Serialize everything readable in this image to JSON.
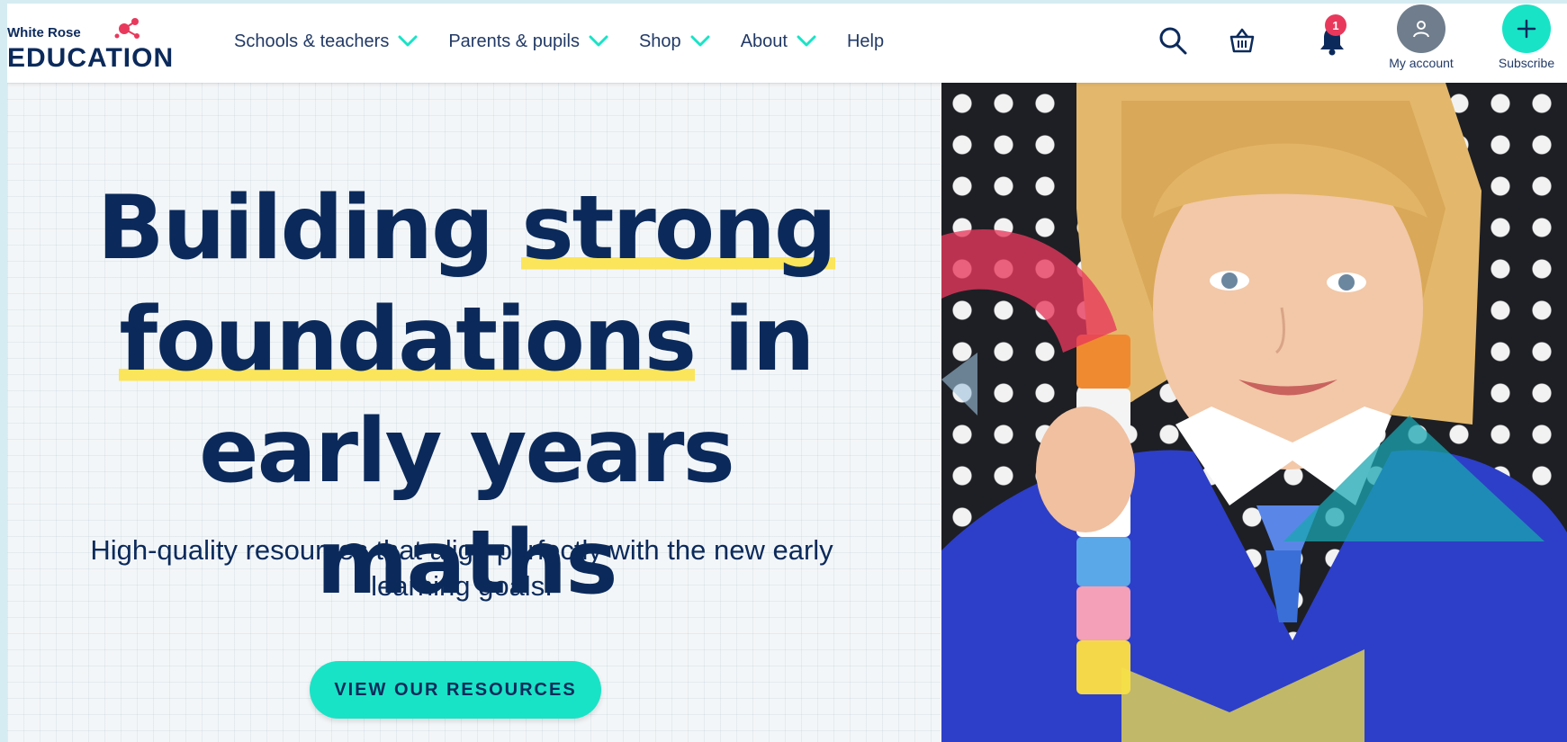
{
  "logo": {
    "line1": "White Rose",
    "line2": "EDUCATION"
  },
  "nav": [
    {
      "label": "Schools & teachers",
      "has_dropdown": true
    },
    {
      "label": "Parents & pupils",
      "has_dropdown": true
    },
    {
      "label": "Shop",
      "has_dropdown": true
    },
    {
      "label": "About",
      "has_dropdown": true
    },
    {
      "label": "Help",
      "has_dropdown": false
    }
  ],
  "header_icons": {
    "search": "search-icon",
    "basket": "basket-icon",
    "notifications": "bell-icon",
    "notification_count": "1",
    "account_label": "My account",
    "subscribe_label": "Subscribe"
  },
  "hero": {
    "headline_part1": "Building ",
    "headline_highlight1": "strong",
    "headline_highlight2": "foundations",
    "headline_part2": " in",
    "headline_line3": "early years maths",
    "subtext": "High-quality resources that align perfectly with the new early learning goals.",
    "cta_label": "VIEW OUR RESOURCES"
  },
  "colors": {
    "navy": "#0b2a5b",
    "accent_teal": "#19e3c6",
    "highlight_yellow": "#fbe55a",
    "badge_red": "#e8395c",
    "account_gray": "#6f7d8c"
  }
}
